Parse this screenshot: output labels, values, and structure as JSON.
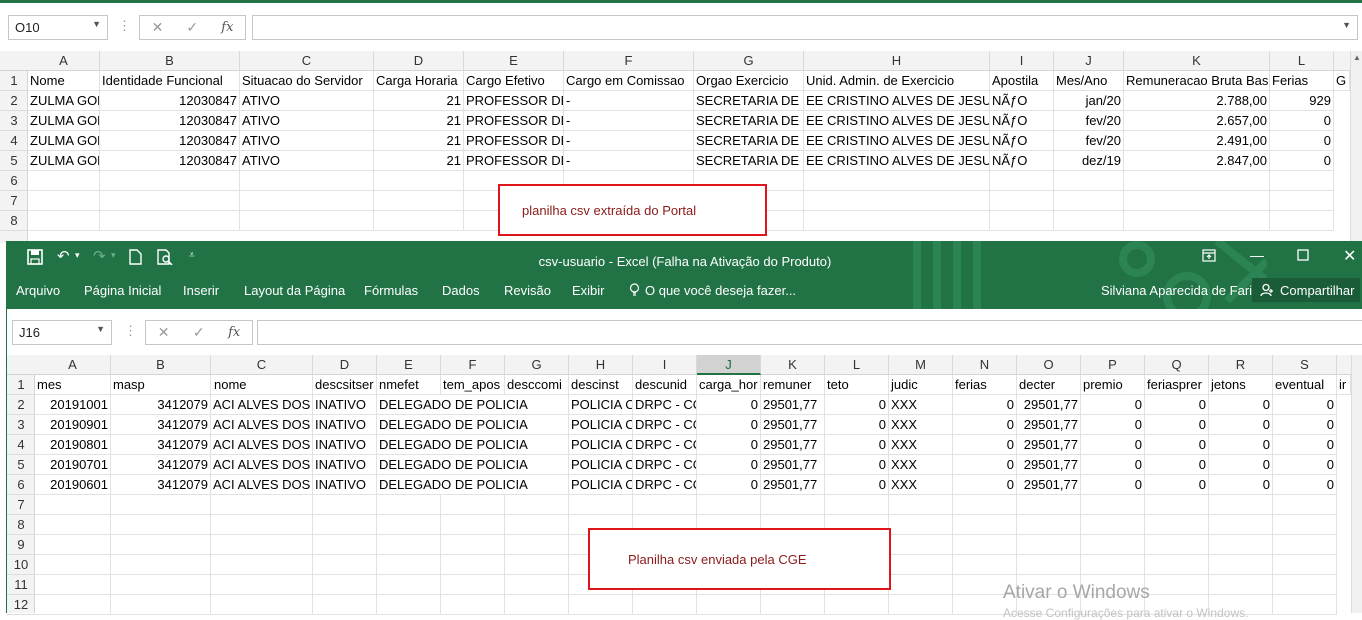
{
  "top_sheet": {
    "name_box": "O10",
    "formula": "",
    "columns": [
      "A",
      "B",
      "C",
      "D",
      "E",
      "F",
      "G",
      "H",
      "I",
      "J",
      "K",
      "L"
    ],
    "rows": [
      "1",
      "2",
      "3",
      "4",
      "5",
      "6",
      "7",
      "8"
    ],
    "header": [
      "Nome",
      "Identidade Funcional",
      "Situacao do Servidor",
      "Carga Horaria",
      "Cargo Efetivo",
      "Cargo em Comissao",
      "Orgao Exercicio",
      "Unid. Admin. de Exercicio",
      "Apostila",
      "Mes/Ano",
      "Remuneracao Bruta Bas",
      "Ferias",
      "G"
    ],
    "data": [
      [
        "ZULMA GON",
        "12030847",
        "ATIVO",
        "21",
        "PROFESSOR DE E",
        "-",
        "SECRETARIA DE EI",
        "EE CRISTINO ALVES DE JESUS",
        "NÃƒO",
        "jan/20",
        "2.788,00",
        "929"
      ],
      [
        "ZULMA GON",
        "12030847",
        "ATIVO",
        "21",
        "PROFESSOR DE E",
        "-",
        "SECRETARIA DE EI",
        "EE CRISTINO ALVES DE JESUS",
        "NÃƒO",
        "fev/20",
        "2.657,00",
        "0"
      ],
      [
        "ZULMA GON",
        "12030847",
        "ATIVO",
        "21",
        "PROFESSOR DE E",
        "-",
        "SECRETARIA DE EI",
        "EE CRISTINO ALVES DE JESUS",
        "NÃƒO",
        "fev/20",
        "2.491,00",
        "0"
      ],
      [
        "ZULMA GON",
        "12030847",
        "ATIVO",
        "21",
        "PROFESSOR DE E",
        "-",
        "SECRETARIA DE EI",
        "EE CRISTINO ALVES DE JESUS",
        "NÃƒO",
        "dez/19",
        "2.847,00",
        "0"
      ]
    ],
    "annotation": "planilha csv extraída do Portal"
  },
  "bottom_window": {
    "title": "csv-usuario  -  Excel (Falha na Ativação do Produto)",
    "menu": [
      "Arquivo",
      "Página Inicial",
      "Inserir",
      "Layout da Página",
      "Fórmulas",
      "Dados",
      "Revisão",
      "Exibir"
    ],
    "tell_me": "O que você deseja fazer...",
    "user": "Silviana Aparecida de Faria",
    "share": "Compartilhar",
    "name_box": "J16",
    "formula": "",
    "columns": [
      "A",
      "B",
      "C",
      "D",
      "E",
      "F",
      "G",
      "H",
      "I",
      "J",
      "K",
      "L",
      "M",
      "N",
      "O",
      "P",
      "Q",
      "R",
      "S"
    ],
    "rows": [
      "1",
      "2",
      "3",
      "4",
      "5",
      "6",
      "7",
      "8",
      "9",
      "10",
      "11",
      "12"
    ],
    "header": [
      "mes",
      "masp",
      "nome",
      "descsitser",
      "nmefet",
      "tem_apos",
      "desccomi",
      "descinst",
      "descunid",
      "carga_hor",
      "remuner",
      "teto",
      "judic",
      "ferias",
      "decter",
      "premio",
      "feriasprer",
      "jetons",
      "eventual",
      "ir"
    ],
    "data": [
      [
        "20191001",
        "3412079",
        "ACI ALVES DOS S",
        "INATIVO",
        "DELEGADO DE POLICIA",
        "",
        "",
        "POLICIA C",
        "DRPC - CO",
        "0",
        "29501,77",
        "0",
        "XXX",
        "0",
        "29501,77",
        "0",
        "0",
        "0",
        "0"
      ],
      [
        "20190901",
        "3412079",
        "ACI ALVES DOS S",
        "INATIVO",
        "DELEGADO DE POLICIA",
        "",
        "",
        "POLICIA C",
        "DRPC - CO",
        "0",
        "29501,77",
        "0",
        "XXX",
        "0",
        "29501,77",
        "0",
        "0",
        "0",
        "0"
      ],
      [
        "20190801",
        "3412079",
        "ACI ALVES DOS S",
        "INATIVO",
        "DELEGADO DE POLICIA",
        "",
        "",
        "POLICIA C",
        "DRPC - CO",
        "0",
        "29501,77",
        "0",
        "XXX",
        "0",
        "29501,77",
        "0",
        "0",
        "0",
        "0"
      ],
      [
        "20190701",
        "3412079",
        "ACI ALVES DOS S",
        "INATIVO",
        "DELEGADO DE POLICIA",
        "",
        "",
        "POLICIA C",
        "DRPC - CO",
        "0",
        "29501,77",
        "0",
        "XXX",
        "0",
        "29501,77",
        "0",
        "0",
        "0",
        "0"
      ],
      [
        "20190601",
        "3412079",
        "ACI ALVES DOS S",
        "INATIVO",
        "DELEGADO DE POLICIA",
        "",
        "",
        "POLICIA C",
        "DRPC - CO",
        "0",
        "29501,77",
        "0",
        "XXX",
        "0",
        "29501,77",
        "0",
        "0",
        "0",
        "0"
      ]
    ],
    "annotation": "Planilha csv enviada pela CGE"
  },
  "watermark": {
    "line1": "Ativar o Windows",
    "line2": "Acesse Configurações para ativar o Windows."
  },
  "colors": {
    "excel_green": "#217346",
    "annotation_border": "#e0151b",
    "annotation_text": "#8b1a1a"
  }
}
